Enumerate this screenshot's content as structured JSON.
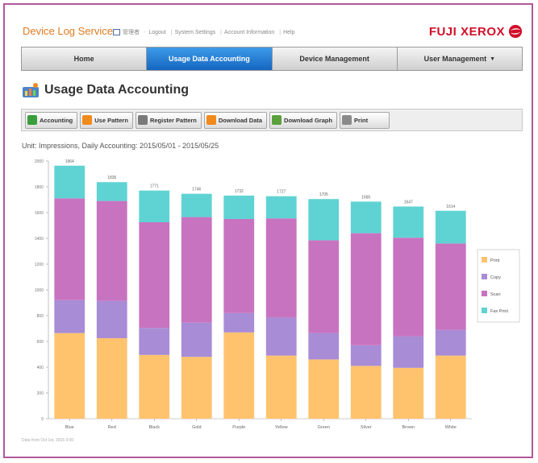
{
  "app": {
    "title": "Device Log Service",
    "user_label": "管理者",
    "links": [
      "Logout",
      "System Settings",
      "Account Information",
      "Help"
    ],
    "brand": "FUJI XEROX"
  },
  "nav": [
    {
      "label": "Home",
      "active": false
    },
    {
      "label": "Usage Data Accounting",
      "active": true
    },
    {
      "label": "Device Management",
      "active": false
    },
    {
      "label": "User Management",
      "active": false
    }
  ],
  "page": {
    "title": "Usage Data Accounting",
    "unit_line": "Unit: Impressions, Daily Accounting: 2015/05/01 - 2015/05/25",
    "footer": "Data from Oct 1st, 2015 9:00"
  },
  "toolbar": {
    "buttons": [
      {
        "label": "Accounting",
        "icon": "accounting-icon",
        "color": "#3a9e3a"
      },
      {
        "label": "Use Pattern",
        "icon": "use-pattern-icon",
        "color": "#f08a1c"
      },
      {
        "label": "Register Pattern",
        "icon": "register-pattern-icon",
        "color": "#7a7a7a"
      },
      {
        "label": "Download Data",
        "icon": "download-data-icon",
        "color": "#f08a1c"
      },
      {
        "label": "Download Graph",
        "icon": "download-graph-icon",
        "color": "#5aa03c"
      },
      {
        "label": "Print",
        "icon": "print-icon",
        "color": "#8a8a8a"
      }
    ]
  },
  "chart_data": {
    "type": "bar",
    "stacked": true,
    "categories": [
      "Blue",
      "Red",
      "Black",
      "Gold",
      "Purple",
      "Yellow",
      "Green",
      "Silver",
      "Brown",
      "White"
    ],
    "totals": [
      "1964",
      "1836",
      "1771",
      "1746",
      "1732",
      "1727",
      "1705",
      "1685",
      "1647",
      "1614"
    ],
    "series": [
      {
        "name": "Print",
        "color": "#ffc36e",
        "values": [
          665,
          625,
          495,
          480,
          670,
          490,
          460,
          410,
          395,
          490
        ]
      },
      {
        "name": "Copy",
        "color": "#a88cd6",
        "values": [
          255,
          290,
          210,
          265,
          150,
          295,
          205,
          160,
          245,
          200
        ]
      },
      {
        "name": "Scan",
        "color": "#c873c0",
        "values": [
          790,
          775,
          820,
          820,
          730,
          770,
          720,
          870,
          765,
          670
        ]
      },
      {
        "name": "Fax Print",
        "color": "#5fd3d3",
        "values": [
          254,
          146,
          246,
          181,
          182,
          172,
          320,
          245,
          242,
          254
        ]
      }
    ],
    "ylim": [
      0,
      2000
    ],
    "yticks": [
      "0",
      "200",
      "400",
      "600",
      "800",
      "1000",
      "1200",
      "1400",
      "1600",
      "1800",
      "2000"
    ],
    "legend": "right",
    "grid": false
  }
}
